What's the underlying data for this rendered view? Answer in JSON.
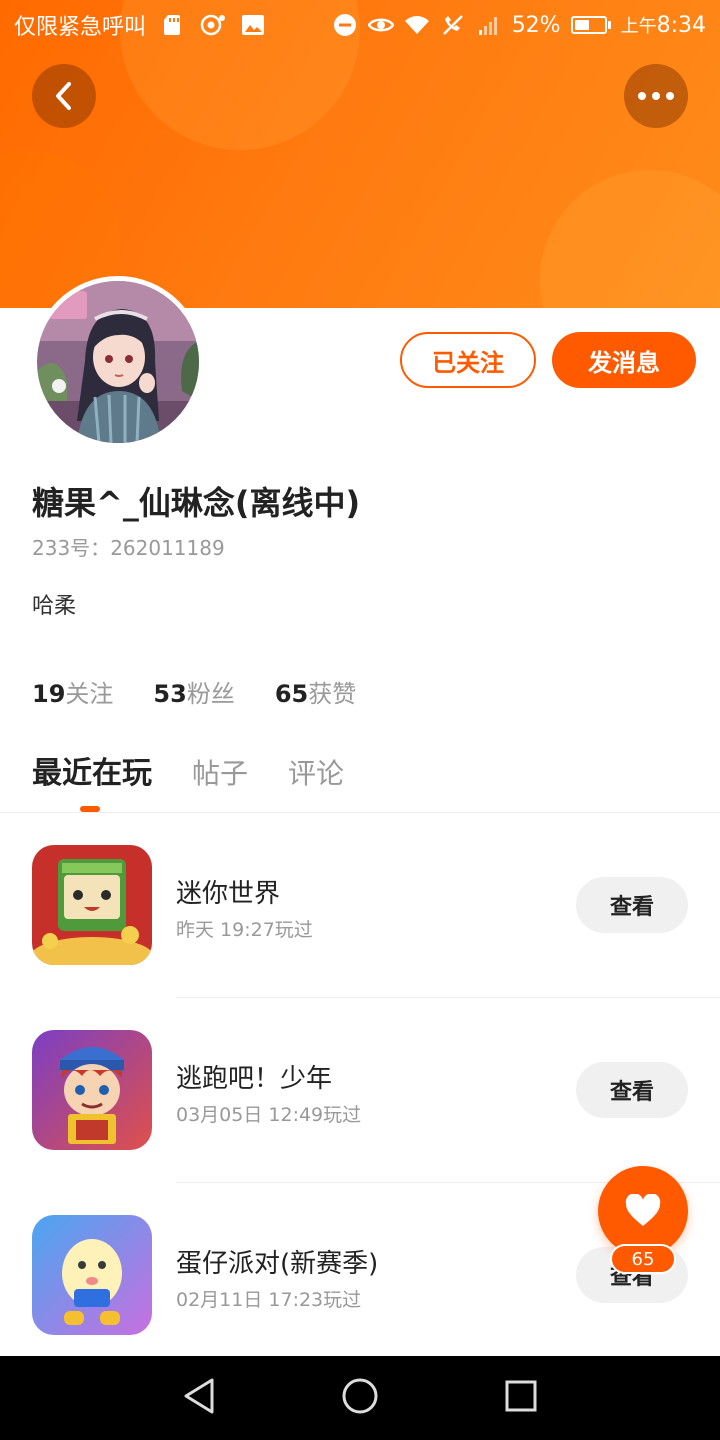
{
  "status_bar": {
    "carrier": "仅限紧急呼叫",
    "battery_pct": "52%",
    "battery_level": 0.52,
    "time_ampm": "上午",
    "time": "8:34",
    "icons": [
      "sd-card-icon",
      "hotspot-icon",
      "image-icon",
      "dnd-icon",
      "eye-icon",
      "wifi-icon",
      "no-call-icon",
      "signal-icon",
      "battery-icon"
    ]
  },
  "header": {
    "back_icon": "chevron-left-icon",
    "more_icon": "more-dots-icon",
    "colors": {
      "gradient_start": "#ff6a00",
      "gradient_end": "#ff8c1a"
    }
  },
  "profile": {
    "follow_label": "已关注",
    "message_label": "发消息",
    "nickname": "糖果^_仙琳念(离线中)",
    "id_label": "233号：",
    "id_value": "262011189",
    "bio": "哈柔",
    "stats": [
      {
        "value": "19",
        "label": "关注"
      },
      {
        "value": "53",
        "label": "粉丝"
      },
      {
        "value": "65",
        "label": "获赞"
      }
    ]
  },
  "tabs": [
    {
      "label": "最近在玩",
      "active": true
    },
    {
      "label": "帖子",
      "active": false
    },
    {
      "label": "评论",
      "active": false
    }
  ],
  "games": [
    {
      "name": "迷你世界",
      "time": "昨天 19:27玩过",
      "button": "查看"
    },
    {
      "name": "逃跑吧！少年",
      "time": "03月05日 12:49玩过",
      "button": "查看"
    },
    {
      "name": "蛋仔派对(新赛季)",
      "time": "02月11日 17:23玩过",
      "button": "查看"
    }
  ],
  "like_fab": {
    "icon": "heart-icon",
    "count": "65"
  },
  "nav": {
    "icons": [
      "back-triangle-icon",
      "home-circle-icon",
      "recents-square-icon"
    ]
  },
  "accent_color": "#ff5a00"
}
